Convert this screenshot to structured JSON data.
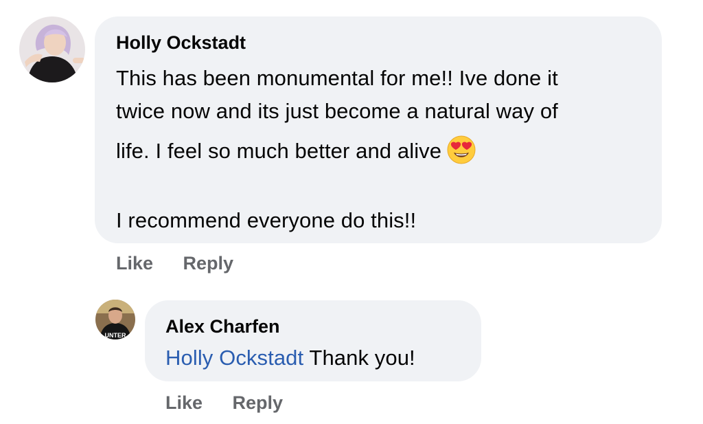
{
  "comments": [
    {
      "author": "Holly Ockstadt",
      "lines": [
        "This has been monumental for me!!  Ive done it",
        "twice now and its just become a natural way of",
        "life.  I feel so much better and alive"
      ],
      "emoji": "heart-eyes-emoji-icon",
      "last_line": "I recommend everyone do this!!",
      "actions": {
        "like": "Like",
        "reply": "Reply"
      }
    },
    {
      "author": "Alex Charfen",
      "mention": "Holly Ockstadt",
      "text": " Thank you!",
      "avatar_shirt_text": "UNTER",
      "actions": {
        "like": "Like",
        "reply": "Reply"
      }
    }
  ],
  "colors": {
    "bubble": "#f0f2f5",
    "mention": "#2a5db0",
    "action_text": "#65676b"
  }
}
